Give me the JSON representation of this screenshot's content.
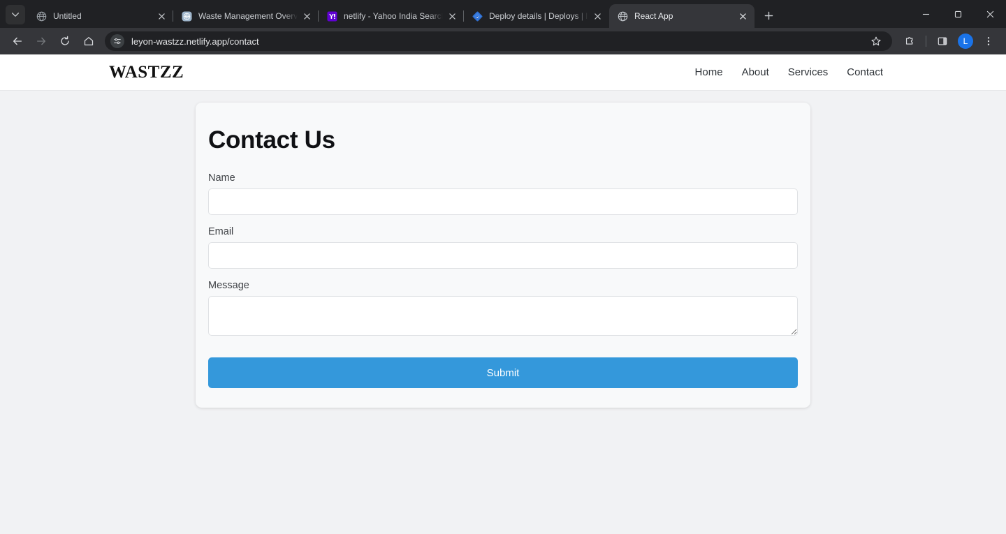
{
  "browser": {
    "tab_search_icon": "chevron-down-icon",
    "tabs": [
      {
        "title": "Untitled",
        "favicon": "globe-icon",
        "active": false
      },
      {
        "title": "Waste Management Overview",
        "favicon": "chatgpt-icon",
        "active": false
      },
      {
        "title": "netlify - Yahoo India Search Res",
        "favicon": "yahoo-icon",
        "active": false
      },
      {
        "title": "Deploy details | Deploys | leyon",
        "favicon": "netlify-icon",
        "active": false
      },
      {
        "title": "React App",
        "favicon": "globe-icon",
        "active": true
      }
    ],
    "new_tab_label": "+",
    "window_controls": {
      "minimize": "minimize-icon",
      "maximize": "maximize-icon",
      "close": "close-icon"
    },
    "toolbar": {
      "back": "back-arrow-icon",
      "forward": "forward-arrow-icon",
      "reload": "reload-icon",
      "home": "home-icon",
      "site_settings_icon": "tune-sliders-icon",
      "url": "leyon-wastzz.netlify.app/contact",
      "bookmark": "star-icon",
      "extensions": "puzzle-icon",
      "side_panel": "side-panel-icon",
      "profile_initial": "L",
      "menu": "three-dot-menu-icon"
    },
    "colors": {
      "tabstrip_bg": "#202124",
      "toolbar_bg": "#35363a",
      "active_tab_bg": "#35363a",
      "avatar_bg": "#1a73e8"
    }
  },
  "site": {
    "brand": "WASTZZ",
    "nav": [
      {
        "label": "Home"
      },
      {
        "label": "About"
      },
      {
        "label": "Services"
      },
      {
        "label": "Contact"
      }
    ],
    "contact": {
      "title": "Contact Us",
      "fields": [
        {
          "label": "Name",
          "value": "",
          "placeholder": ""
        },
        {
          "label": "Email",
          "value": "",
          "placeholder": ""
        },
        {
          "label": "Message",
          "value": "",
          "placeholder": ""
        }
      ],
      "submit_label": "Submit"
    },
    "colors": {
      "page_bg": "#f1f2f4",
      "header_bg": "#ffffff",
      "card_bg": "#f8f9fa",
      "submit_bg": "#3498db",
      "input_border": "#dfe1e4"
    }
  }
}
